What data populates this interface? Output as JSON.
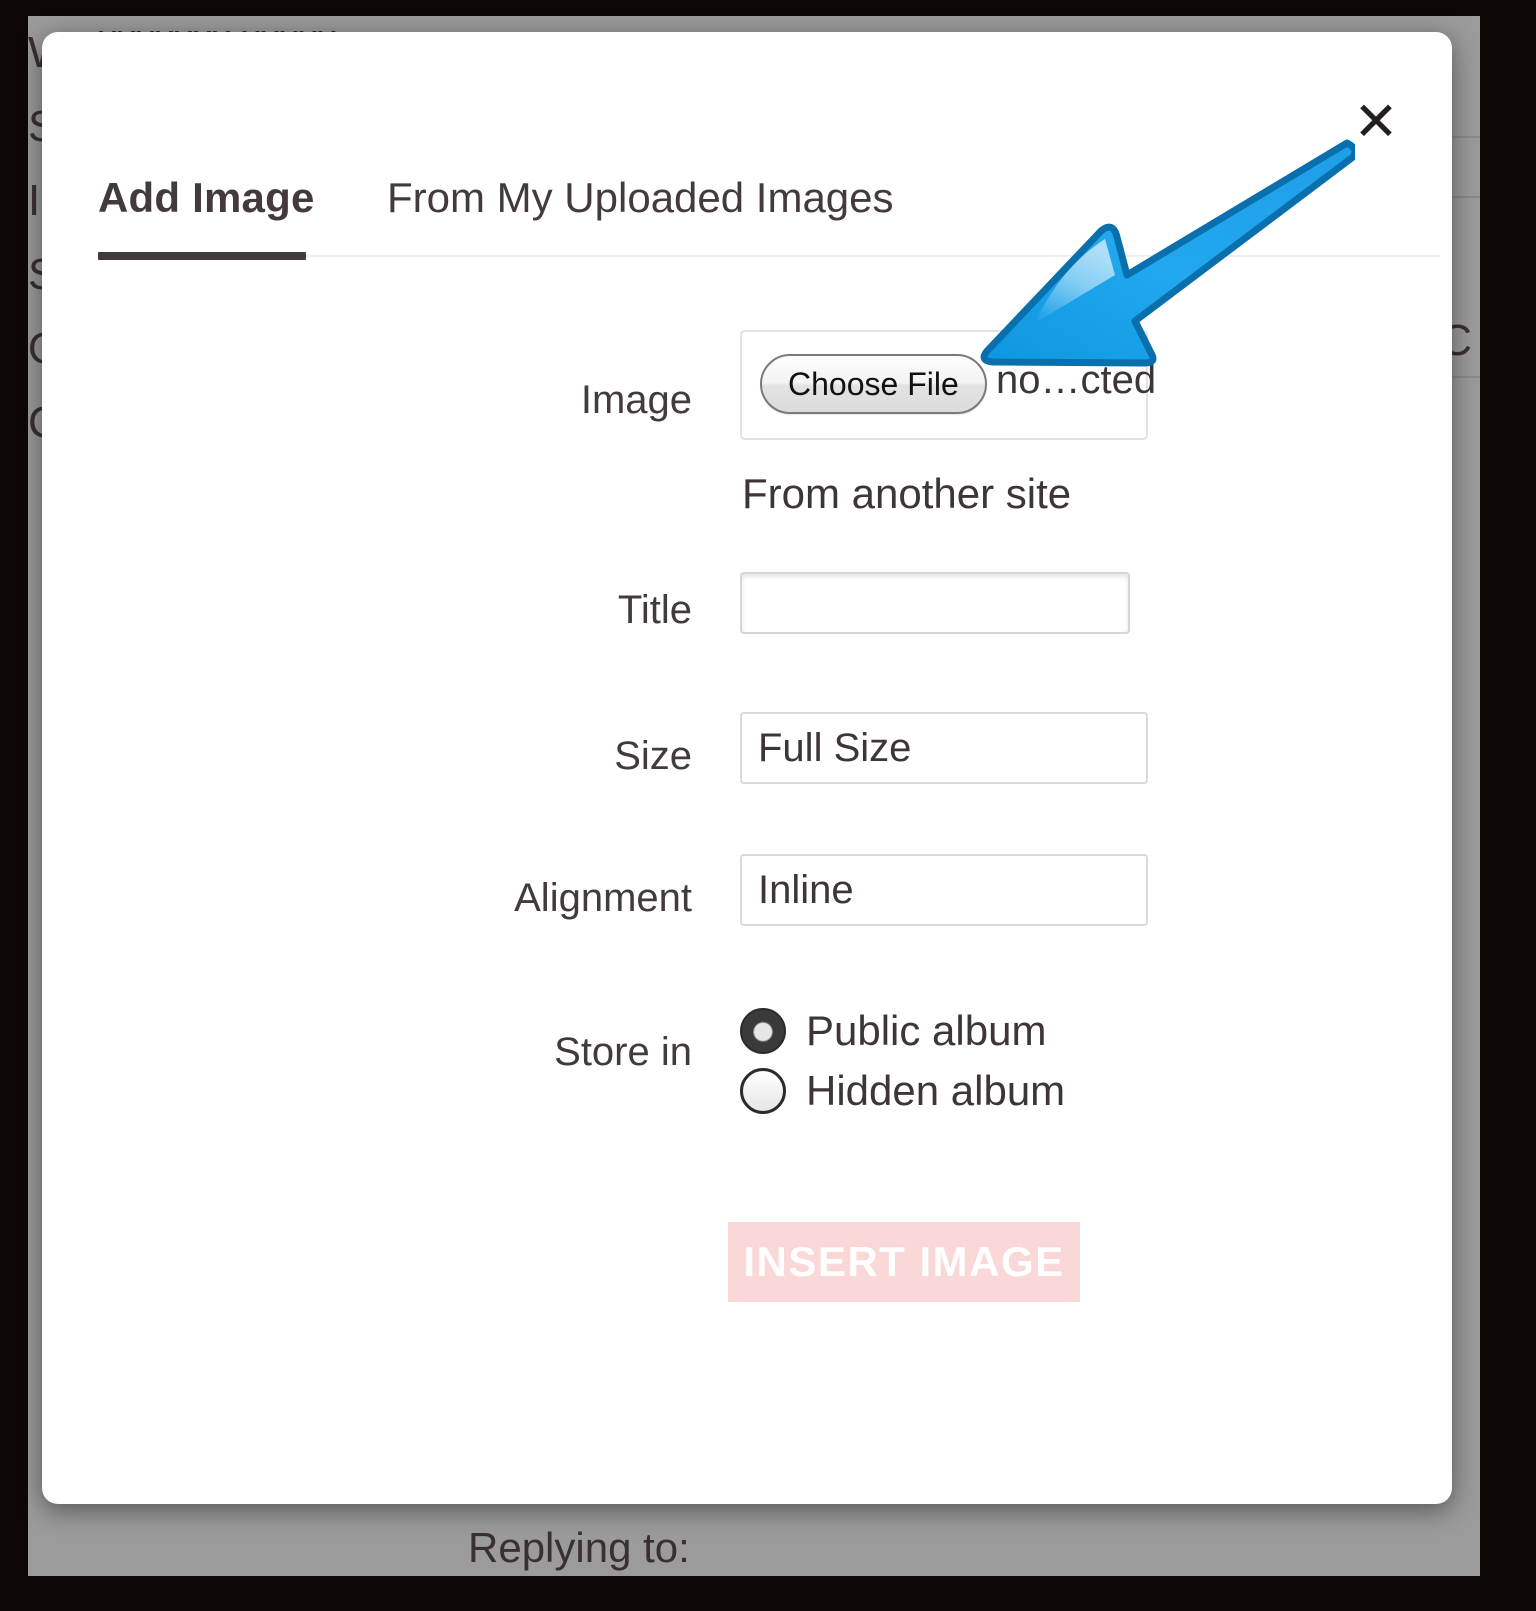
{
  "modal": {
    "close_label": "✕",
    "tabs": [
      {
        "label": "Add Image",
        "active": true
      },
      {
        "label": "From My Uploaded Images",
        "active": false
      }
    ],
    "fields": {
      "image": {
        "label": "Image",
        "choose_file_label": "Choose File",
        "file_status": "no…cted",
        "from_another_site_label": "From another site"
      },
      "title": {
        "label": "Title",
        "value": "",
        "placeholder": ""
      },
      "size": {
        "label": "Size",
        "value": "Full Size"
      },
      "alignment": {
        "label": "Alignment",
        "value": "Inline"
      },
      "store_in": {
        "label": "Store in",
        "options": [
          {
            "label": "Public album",
            "selected": true
          },
          {
            "label": "Hidden album",
            "selected": false
          }
        ]
      }
    },
    "submit": {
      "label": "INSERT IMAGE",
      "disabled": true,
      "bg_color": "#fbd8d8",
      "text_color": "#ffffff"
    }
  },
  "annotation": {
    "type": "arrow",
    "color": "#1ba1e8",
    "outline_color": "#0a6fad",
    "points_to": "choose-file-button"
  },
  "background": {
    "top_text": "xxxxxxx xxxxx",
    "left_column_text": "WTBE\nSJXE\nIGEW\nSTBV\nOGAT\nCSC",
    "bottom_text": "Replying to:",
    "right_text": "C",
    "page_color": "#9b9b9b",
    "backdrop_color": "#0d0806"
  }
}
